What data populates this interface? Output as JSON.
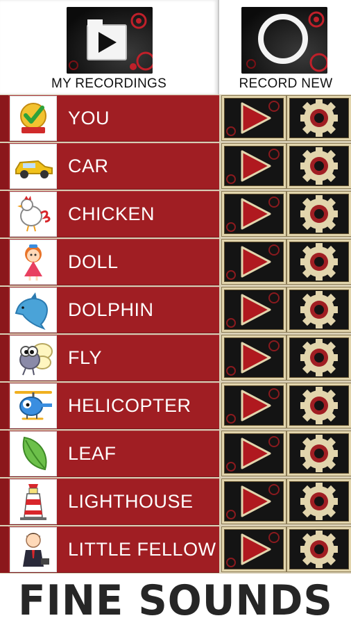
{
  "header": {
    "my_recordings": {
      "label": "MY RECORDINGS",
      "icon": "play-icon"
    },
    "record_new": {
      "label": "RECORD NEW",
      "icon": "record-ring-icon"
    }
  },
  "items": [
    {
      "label": "YOU",
      "icon": "gold-checkmark-badge-icon"
    },
    {
      "label": "CAR",
      "icon": "car-icon"
    },
    {
      "label": "CHICKEN",
      "icon": "chicken-icon"
    },
    {
      "label": "DOLL",
      "icon": "doll-icon"
    },
    {
      "label": "DOLPHIN",
      "icon": "dolphin-icon"
    },
    {
      "label": "FLY",
      "icon": "fly-icon"
    },
    {
      "label": "HELICOPTER",
      "icon": "helicopter-icon"
    },
    {
      "label": "LEAF",
      "icon": "leaf-icon"
    },
    {
      "label": "LIGHTHOUSE",
      "icon": "lighthouse-icon"
    },
    {
      "label": "LITTLE FELLOW",
      "icon": "little-fellow-icon"
    }
  ],
  "row_actions": {
    "play_icon": "play-triangle-icon",
    "settings_icon": "gear-icon"
  },
  "footer": {
    "title": "FINE SOUNDS"
  },
  "colors": {
    "row_background": "#a01e23",
    "button_frame": "#e2d5ad",
    "button_background": "#141414",
    "accent_red": "#c0202a"
  }
}
